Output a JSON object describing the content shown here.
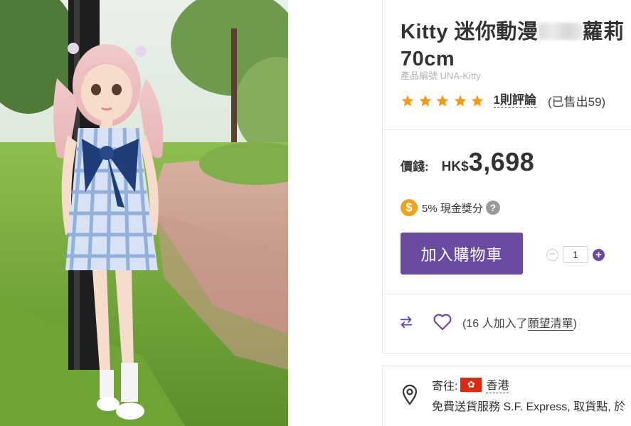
{
  "product": {
    "title_prefix": "Kitty 迷你動漫",
    "title_suffix": "蘿莉 70cm",
    "sku": "產品編號 UNA-Kitty",
    "rating_stars": 5,
    "review_link": "1則評論",
    "sold": "(已售出59)"
  },
  "pricing": {
    "label": "價錢:",
    "currency": "HK$",
    "amount": "3,698"
  },
  "reward": {
    "coin_symbol": "$",
    "text": "5% 現金獎分",
    "help_symbol": "?"
  },
  "cart": {
    "button_label": "加入購物車",
    "quantity": "1",
    "minus_symbol": "−",
    "plus_symbol": "+"
  },
  "wishlist": {
    "prefix": "(16 人加入了",
    "link": "願望清單",
    "suffix": ")"
  },
  "shipping": {
    "ship_to_label": "寄往:",
    "region": "香港",
    "service": "免費送貨服務 S.F. Express, 取貨點, 於"
  },
  "colors": {
    "accent": "#6a4ba2",
    "star": "#f29b1b",
    "coin": "#f0a21a"
  },
  "icons": [
    "star-icon",
    "coin-icon",
    "help-icon",
    "compare-icon",
    "heart-icon",
    "location-pin-icon",
    "hk-flag-icon"
  ]
}
